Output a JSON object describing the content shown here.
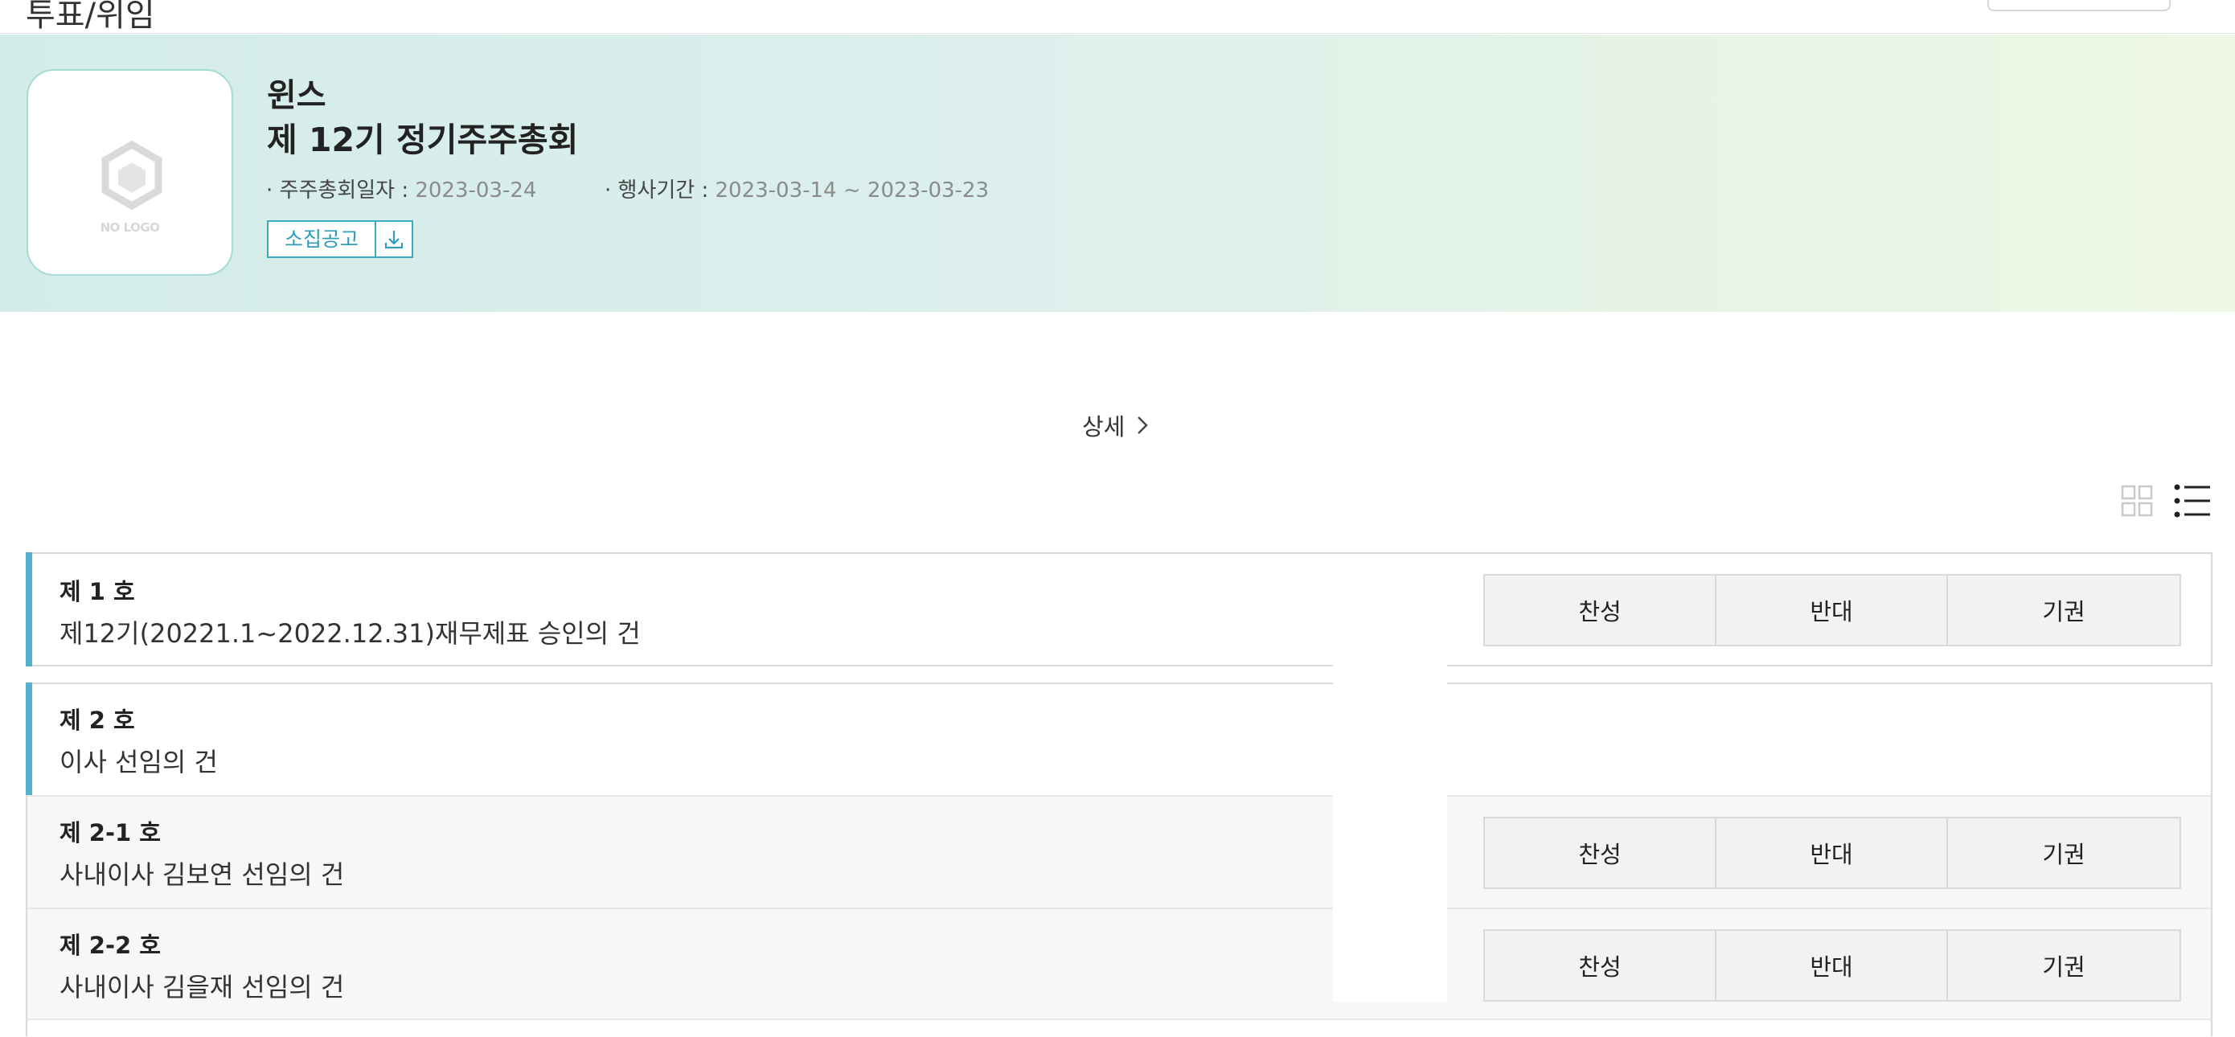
{
  "page": {
    "title": "투표/위임"
  },
  "company": {
    "name": "윈스",
    "meeting": "제 12기 정기주주총회",
    "logo_placeholder": "NO LOGO",
    "meeting_date_label": "· 주주총회일자 : ",
    "meeting_date": "2023-03-24",
    "event_period_label": "· 행사기간 : ",
    "event_period": "2023-03-14 ~ 2023-03-23",
    "notice_label": "소집공고",
    "download_icon": "download-icon"
  },
  "detail_link": "상세",
  "view_toggle": {
    "grid": "grid-view-icon",
    "list": "list-view-icon"
  },
  "vote_labels": {
    "for": "찬성",
    "against": "반대",
    "abstain": "기권"
  },
  "agenda": [
    {
      "no": "제 1 호",
      "title": "제12기(20221.1~2022.12.31)재무제표 승인의 건"
    },
    {
      "no": "제 2 호",
      "title": "이사 선임의 건",
      "sub_items": [
        {
          "no": "제 2-1 호",
          "title": "사내이사 김보연 선임의 건"
        },
        {
          "no": "제 2-2 호",
          "title": "사내이사 김을재 선임의 건"
        }
      ]
    }
  ],
  "colors": {
    "accent": "#56b0cc",
    "notice": "#3aaac2",
    "banner_start": "#d3ecea",
    "banner_end": "#eef7e4"
  }
}
